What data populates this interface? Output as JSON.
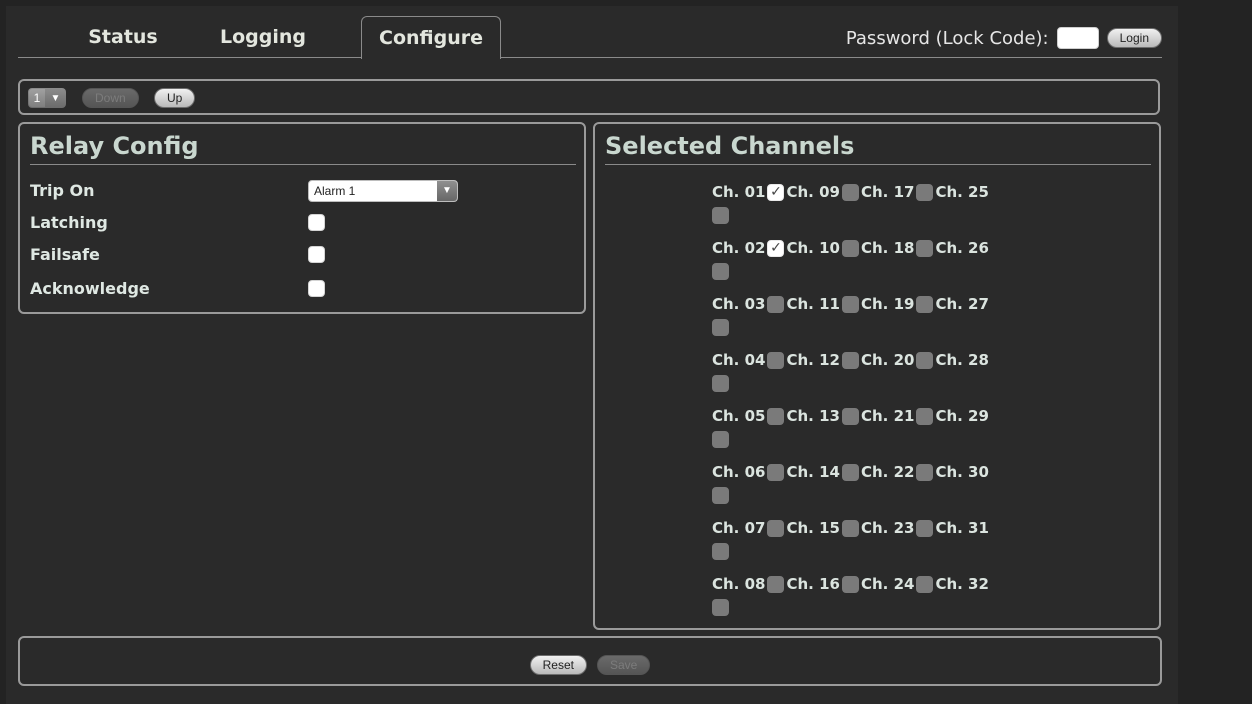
{
  "tabs": [
    {
      "label": "Status",
      "active": false
    },
    {
      "label": "Logging",
      "active": false
    },
    {
      "label": "Configure",
      "active": true
    }
  ],
  "login": {
    "label": "Password (Lock Code):",
    "password_value": "",
    "button": "Login"
  },
  "toolbar": {
    "relay_select": "1",
    "down_label": "Down",
    "up_label": "Up"
  },
  "relay_config": {
    "title": "Relay Config",
    "trip_on_label": "Trip On",
    "trip_on_value": "Alarm 1",
    "latching_label": "Latching",
    "latching_checked": false,
    "failsafe_label": "Failsafe",
    "failsafe_checked": false,
    "acknowledge_label": "Acknowledge",
    "acknowledge_checked": false
  },
  "selected_channels": {
    "title": "Selected Channels",
    "rows": [
      [
        {
          "label": "Ch. 01",
          "checked": true
        },
        {
          "label": "Ch. 09",
          "checked": false
        },
        {
          "label": "Ch. 17",
          "checked": false
        },
        {
          "label": "Ch. 25",
          "checked": false
        }
      ],
      [
        {
          "label": "Ch. 02",
          "checked": true
        },
        {
          "label": "Ch. 10",
          "checked": false
        },
        {
          "label": "Ch. 18",
          "checked": false
        },
        {
          "label": "Ch. 26",
          "checked": false
        }
      ],
      [
        {
          "label": "Ch. 03",
          "checked": false
        },
        {
          "label": "Ch. 11",
          "checked": false
        },
        {
          "label": "Ch. 19",
          "checked": false
        },
        {
          "label": "Ch. 27",
          "checked": false
        }
      ],
      [
        {
          "label": "Ch. 04",
          "checked": false
        },
        {
          "label": "Ch. 12",
          "checked": false
        },
        {
          "label": "Ch. 20",
          "checked": false
        },
        {
          "label": "Ch. 28",
          "checked": false
        }
      ],
      [
        {
          "label": "Ch. 05",
          "checked": false
        },
        {
          "label": "Ch. 13",
          "checked": false
        },
        {
          "label": "Ch. 21",
          "checked": false
        },
        {
          "label": "Ch. 29",
          "checked": false
        }
      ],
      [
        {
          "label": "Ch. 06",
          "checked": false
        },
        {
          "label": "Ch. 14",
          "checked": false
        },
        {
          "label": "Ch. 22",
          "checked": false
        },
        {
          "label": "Ch. 30",
          "checked": false
        }
      ],
      [
        {
          "label": "Ch. 07",
          "checked": false
        },
        {
          "label": "Ch. 15",
          "checked": false
        },
        {
          "label": "Ch. 23",
          "checked": false
        },
        {
          "label": "Ch. 31",
          "checked": false
        }
      ],
      [
        {
          "label": "Ch. 08",
          "checked": false
        },
        {
          "label": "Ch. 16",
          "checked": false
        },
        {
          "label": "Ch. 24",
          "checked": false
        },
        {
          "label": "Ch. 32",
          "checked": false
        }
      ]
    ]
  },
  "footer": {
    "reset_label": "Reset",
    "save_label": "Save"
  },
  "colors": {
    "background": "#2a2a2a",
    "border": "#9a9a9a",
    "heading": "#c9d7cf"
  }
}
